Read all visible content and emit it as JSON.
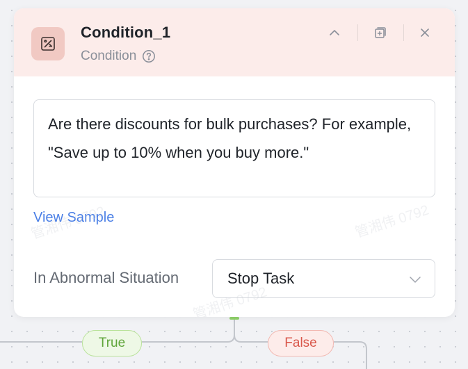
{
  "node": {
    "title": "Condition_1",
    "subtitle": "Condition",
    "icon": "percent-discount-icon",
    "header_color": "#fcecea",
    "icon_bg_color": "#f1c9c3"
  },
  "header_actions": {
    "collapse_icon": "chevron-up-icon",
    "copy_icon": "copy-add-icon",
    "close_icon": "close-icon"
  },
  "condition_text": "Are there discounts for bulk purchases? For example, \"Save up to 10% when you buy more.\"",
  "view_sample_label": "View Sample",
  "abnormal": {
    "label": "In Abnormal Situation",
    "selected": "Stop Task"
  },
  "watermark_text": "管湘伟 0792",
  "branches": {
    "true_label": "True",
    "false_label": "False",
    "true_color": "#5fa53a",
    "false_color": "#d9574b"
  },
  "colors": {
    "link": "#4a7fe6",
    "canvas": "#f1f2f5"
  }
}
